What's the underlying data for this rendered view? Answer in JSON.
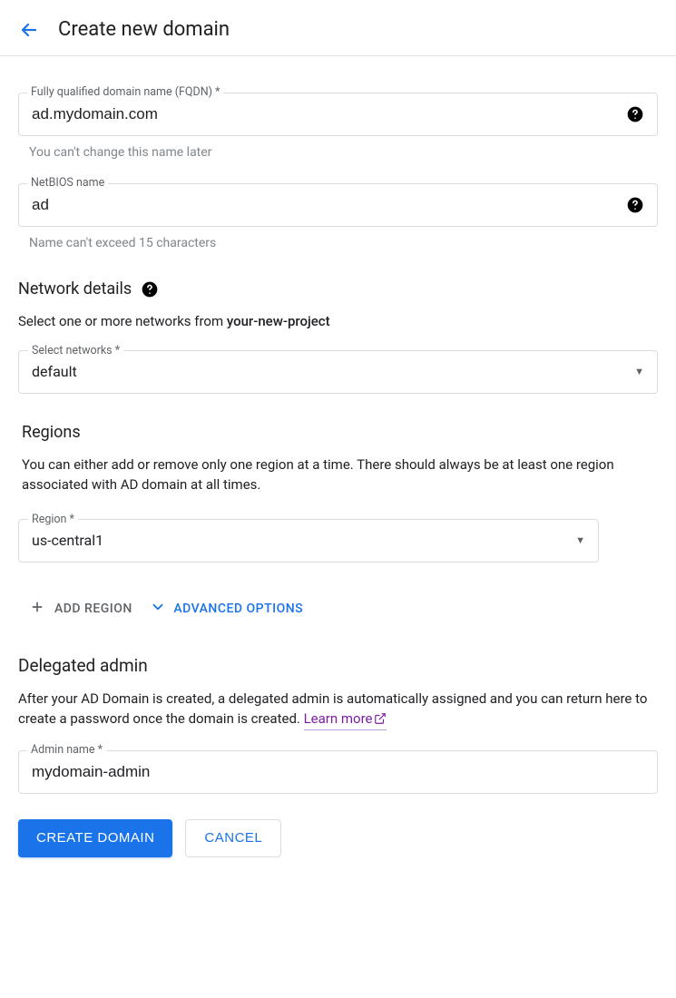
{
  "header": {
    "title": "Create new domain"
  },
  "fqdn": {
    "label": "Fully qualified domain name (FQDN) *",
    "value": "ad.mydomain.com",
    "hint": "You can't change this name later"
  },
  "netbios": {
    "label": "NetBIOS name",
    "value": "ad",
    "hint": "Name can't exceed 15 characters"
  },
  "network": {
    "title": "Network details",
    "description_prefix": "Select one or more networks from ",
    "project_name": "your-new-project",
    "select": {
      "label": "Select networks *",
      "value": "default"
    }
  },
  "regions": {
    "title": "Regions",
    "description": "You can either add or remove only one region at a time. There should always be at least one region associated with AD domain at all times.",
    "select": {
      "label": "Region *",
      "value": "us-central1"
    },
    "add_button": "ADD REGION"
  },
  "advanced_options_label": "ADVANCED OPTIONS",
  "delegated": {
    "title": "Delegated admin",
    "description": "After your AD Domain is created, a delegated admin is automatically assigned and you can return here to create a password once the domain is created. ",
    "learn_more": "Learn more",
    "admin": {
      "label": "Admin name *",
      "value": "mydomain-admin"
    }
  },
  "buttons": {
    "create": "CREATE DOMAIN",
    "cancel": "CANCEL"
  }
}
